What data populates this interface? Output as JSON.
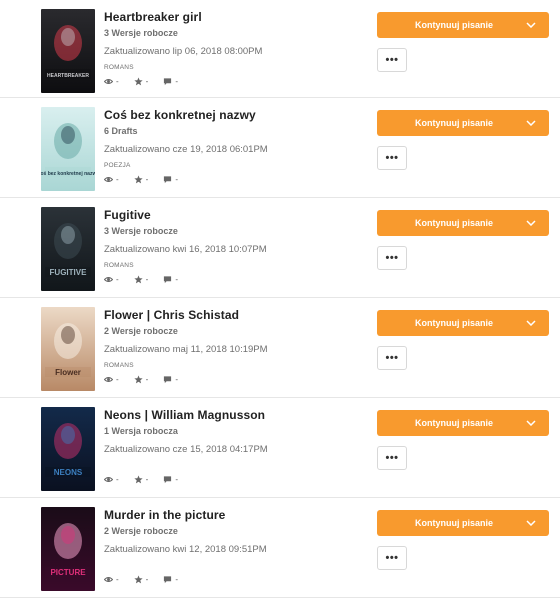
{
  "stories": [
    {
      "title": "Heartbreaker girl",
      "drafts": "3 Wersje robocze",
      "updated": "Zaktualizowano lip 06, 2018 08:00PM",
      "tag": "ROMANS",
      "views": "-",
      "votes": "-",
      "comments": "-",
      "continue_label": "Kontynuuj pisanie",
      "more_label": "•••",
      "cover_colors": [
        "#2a2a2e",
        "#0d0d10",
        "#c8c8cc",
        "#d43a4a"
      ],
      "cover_text": "HEARTBREAKER"
    },
    {
      "title": "Coś bez konkretnej nazwy",
      "drafts": "6 Drafts",
      "updated": "Zaktualizowano cze 19, 2018 06:01PM",
      "tag": "POEZJA",
      "views": "-",
      "votes": "-",
      "comments": "-",
      "continue_label": "Kontynuuj pisanie",
      "more_label": "•••",
      "cover_colors": [
        "#d9efef",
        "#a9d6d4",
        "#1f3a4a",
        "#6aaca8"
      ],
      "cover_text": "Coś bez konkretnej nazwy"
    },
    {
      "title": "Fugitive",
      "drafts": "3 Wersje robocze",
      "updated": "Zaktualizowano kwi 16, 2018 10:07PM",
      "tag": "ROMANS",
      "views": "-",
      "votes": "-",
      "comments": "-",
      "continue_label": "Kontynuuj pisanie",
      "more_label": "•••",
      "cover_colors": [
        "#2b3238",
        "#11161a",
        "#9fb3bd",
        "#3d4a52"
      ],
      "cover_text": "FUGITIVE"
    },
    {
      "title": "Flower | Chris Schistad",
      "drafts": "2 Wersje robocze",
      "updated": "Zaktualizowano maj 11, 2018 10:19PM",
      "tag": "ROMANS",
      "views": "-",
      "votes": "-",
      "comments": "-",
      "continue_label": "Kontynuuj pisanie",
      "more_label": "•••",
      "cover_colors": [
        "#ecd9c6",
        "#b88966",
        "#4a2e22",
        "#f5ece2"
      ],
      "cover_text": "Flower"
    },
    {
      "title": "Neons | William Magnusson",
      "drafts": "1 Wersja robocza",
      "updated": "Zaktualizowano cze 15, 2018 04:17PM",
      "tag": "",
      "views": "-",
      "votes": "-",
      "comments": "-",
      "continue_label": "Kontynuuj pisanie",
      "more_label": "•••",
      "cover_colors": [
        "#132a4a",
        "#0a1020",
        "#3c7fc0",
        "#c0306a"
      ],
      "cover_text": "NEONS"
    },
    {
      "title": "Murder in the picture",
      "drafts": "2 Wersje robocze",
      "updated": "Zaktualizowano kwi 12, 2018 09:51PM",
      "tag": "",
      "views": "-",
      "votes": "-",
      "comments": "-",
      "continue_label": "Kontynuuj pisanie",
      "more_label": "•••",
      "cover_colors": [
        "#1a0c18",
        "#3a0a2a",
        "#e0307a",
        "#f2a0c8"
      ],
      "cover_text": "PICTURE"
    }
  ],
  "accent_color": "#f89a2e"
}
